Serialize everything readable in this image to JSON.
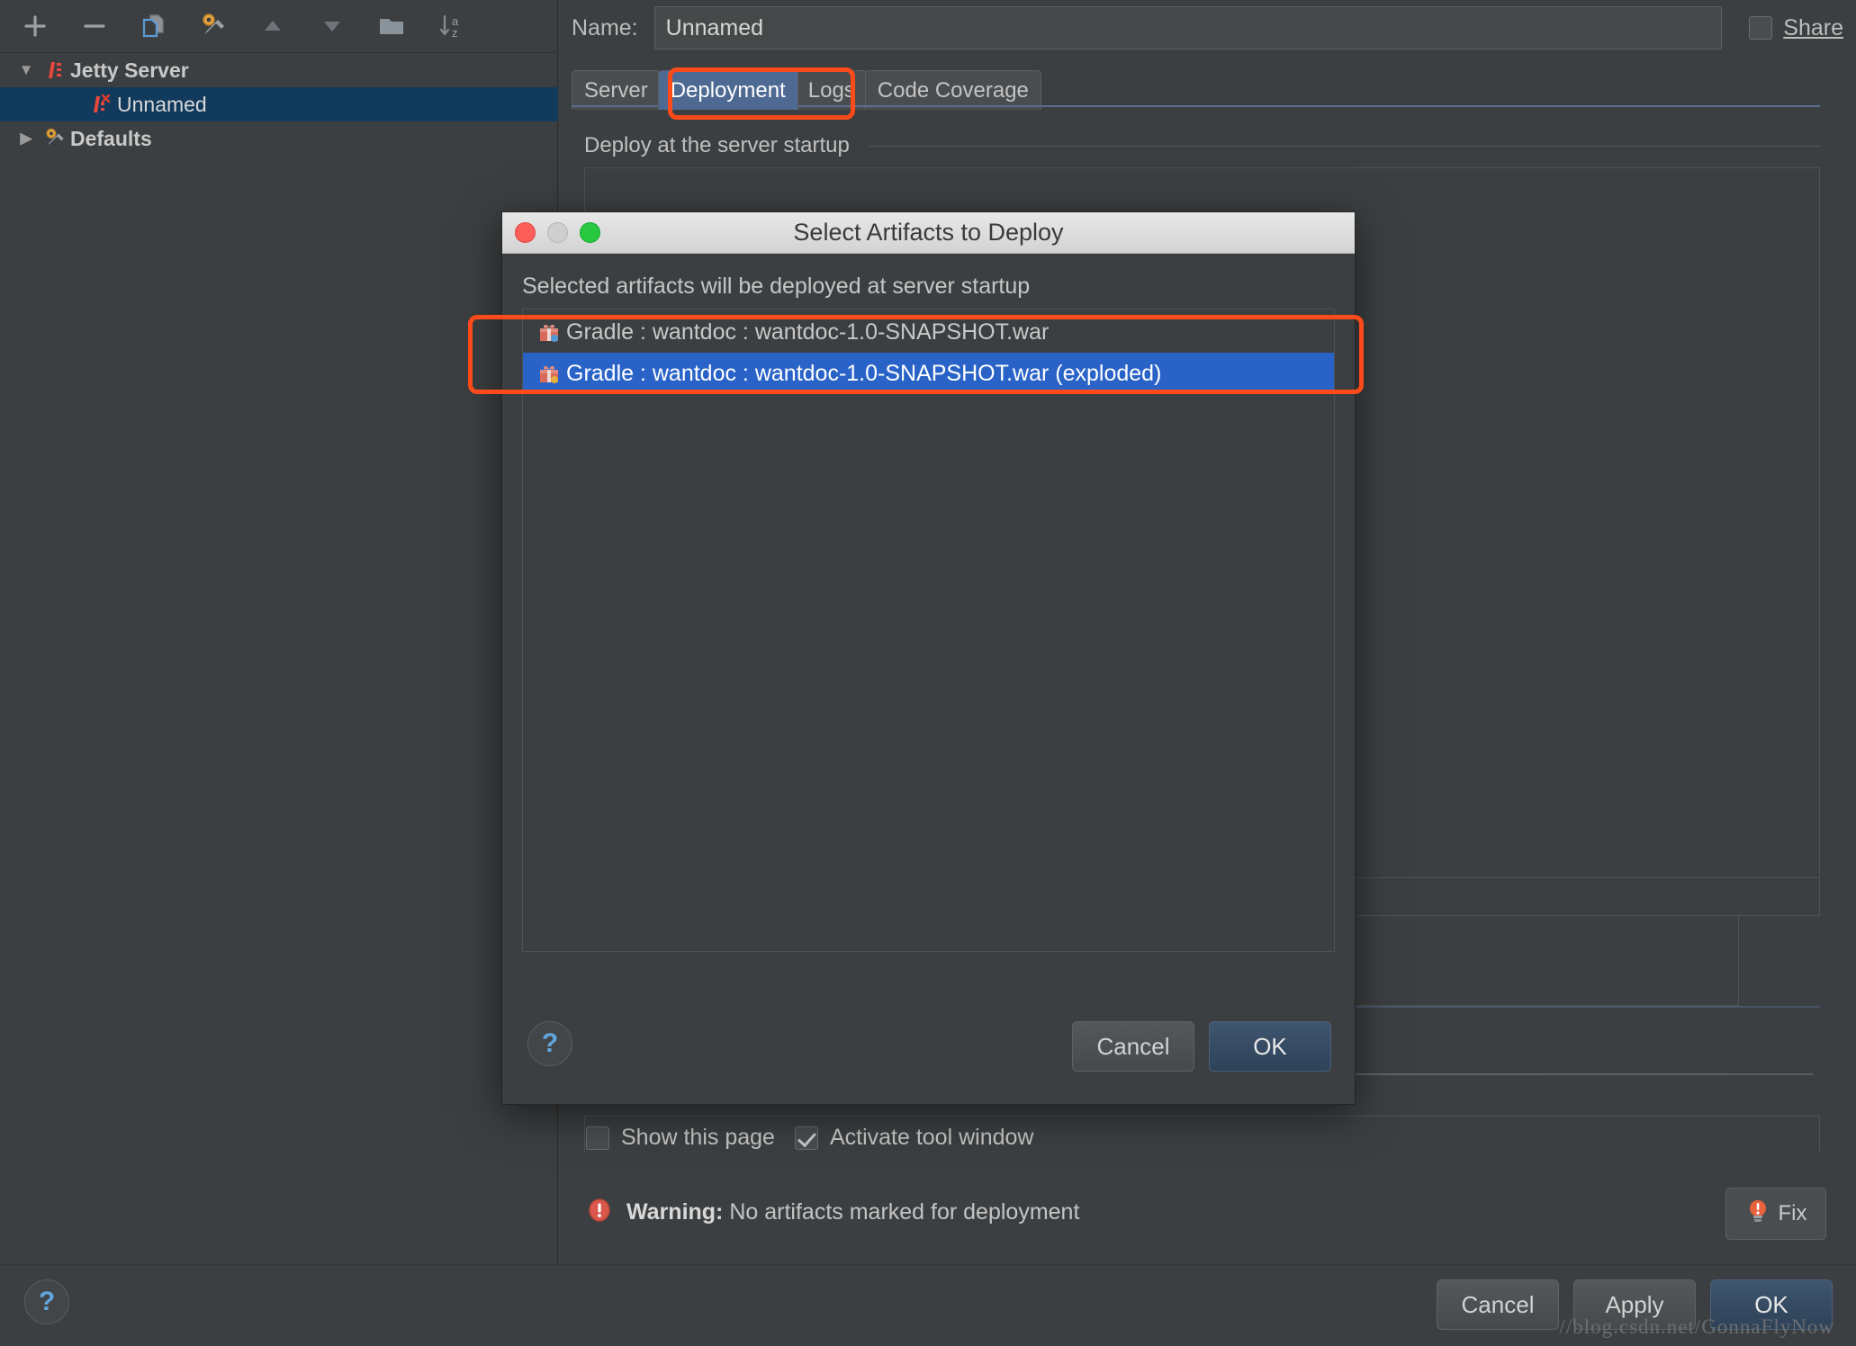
{
  "sidebar": {
    "toolbar": [
      {
        "name": "add-button",
        "icon": "plus-icon",
        "label": "Add"
      },
      {
        "name": "remove-button",
        "icon": "minus-icon",
        "label": "Remove"
      },
      {
        "name": "copy-button",
        "icon": "copy-icon",
        "label": "Copy Configuration"
      },
      {
        "name": "edit-defaults-button",
        "icon": "wrench-icon",
        "label": "Edit defaults"
      },
      {
        "name": "move-up-button",
        "icon": "triangle-up-icon",
        "label": "Move Up"
      },
      {
        "name": "move-down-button",
        "icon": "triangle-down-icon",
        "label": "Move Down"
      },
      {
        "name": "folder-button",
        "icon": "folder-icon",
        "label": "Create New Folder"
      },
      {
        "name": "sort-button",
        "icon": "sort-az-icon",
        "label": "Sort Configurations"
      }
    ],
    "tree": [
      {
        "label": "Jetty Server",
        "icon": "jetty-icon",
        "expander": "▼",
        "level": 0,
        "bold": true,
        "selected": false
      },
      {
        "label": "Unnamed",
        "icon": "jetty-error-icon",
        "expander": "",
        "level": 1,
        "bold": false,
        "selected": true
      },
      {
        "label": "Defaults",
        "icon": "wrench-icon",
        "expander": "▶",
        "level": 0,
        "bold": true,
        "selected": false
      }
    ]
  },
  "header": {
    "name_label": "Name:",
    "name_value": "Unnamed",
    "name_placeholder": "Unnamed",
    "share_label": "Share",
    "share_checked": false
  },
  "tabs": [
    {
      "label": "Server",
      "active": false
    },
    {
      "label": "Deployment",
      "active": true
    },
    {
      "label": "Logs",
      "active": false
    },
    {
      "label": "Code Coverage",
      "active": false
    }
  ],
  "deployment": {
    "section_label": "Deploy at the server startup",
    "checkboxes": [
      {
        "label": "Show this page",
        "checked": false
      },
      {
        "label": "Activate tool window",
        "checked": true
      }
    ],
    "warning_prefix": "Warning:",
    "warning_text": "No artifacts marked for deployment",
    "fix_label": "Fix",
    "fix_icon": "lightbulb-warning-icon"
  },
  "modal": {
    "title": "Select Artifacts to Deploy",
    "subtitle": "Selected artifacts will be deployed at server startup",
    "artifacts": [
      {
        "label": "Gradle : wantdoc : wantdoc-1.0-SNAPSHOT.war",
        "icon": "artifact-war-icon",
        "selected": false
      },
      {
        "label": "Gradle : wantdoc : wantdoc-1.0-SNAPSHOT.war (exploded)",
        "icon": "artifact-war-exploded-icon",
        "selected": true
      }
    ],
    "help_glyph": "?",
    "cancel_label": "Cancel",
    "ok_label": "OK"
  },
  "bottom": {
    "help_glyph": "?",
    "cancel_label": "Cancel",
    "apply_label": "Apply",
    "ok_label": "OK"
  },
  "watermark": "//blog.csdn.net/GonnaFlyNow",
  "colors": {
    "background": "#3c3f41",
    "selection_blue": "#2a63c8",
    "tree_selection": "#113a5c",
    "tab_active": "#4e6a93",
    "annotation_red": "#fc4a1a",
    "primary_button": "#3f566f"
  }
}
